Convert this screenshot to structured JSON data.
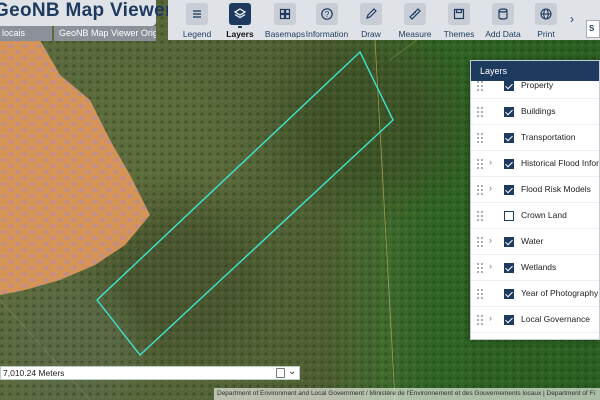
{
  "app": {
    "title": "GeoNB Map Viewer",
    "subtab_left": "locais",
    "subtab_right": "GeoNB Map Viewer Original"
  },
  "toolbar": {
    "tools": [
      {
        "label": "Legend",
        "icon": "list-icon",
        "active": false
      },
      {
        "label": "Layers",
        "icon": "layers-icon",
        "active": true
      },
      {
        "label": "Basemaps",
        "icon": "grid-icon",
        "active": false
      },
      {
        "label": "Information",
        "icon": "question-icon",
        "active": false
      },
      {
        "label": "Draw",
        "icon": "pen-icon",
        "active": false
      },
      {
        "label": "Measure",
        "icon": "ruler-icon",
        "active": false
      },
      {
        "label": "Themes",
        "icon": "save-icon",
        "active": false
      },
      {
        "label": "Add Data",
        "icon": "database-icon",
        "active": false
      },
      {
        "label": "Print",
        "icon": "globe-icon",
        "active": false
      }
    ],
    "more_icon": "chevron-right-icon",
    "search_stub": "S"
  },
  "layers_panel": {
    "title": "Layers",
    "layers": [
      {
        "name": "Property",
        "checked": true,
        "expandable": false
      },
      {
        "name": "Buildings",
        "checked": true,
        "expandable": false
      },
      {
        "name": "Transportation",
        "checked": true,
        "expandable": false
      },
      {
        "name": "Historical Flood Informa",
        "checked": true,
        "expandable": true
      },
      {
        "name": "Flood Risk Models",
        "checked": true,
        "expandable": true
      },
      {
        "name": "Crown Land",
        "checked": false,
        "expandable": false
      },
      {
        "name": "Water",
        "checked": true,
        "expandable": true
      },
      {
        "name": "Wetlands",
        "checked": true,
        "expandable": true
      },
      {
        "name": "Year of Photography",
        "checked": true,
        "expandable": false
      },
      {
        "name": "Local Governance",
        "checked": true,
        "expandable": true
      }
    ]
  },
  "scale": {
    "text": "7,010.24 Meters"
  },
  "attribution": "Department of Environment and Local Government / Ministère de l'Environnement et des Gouvernements locaux | Department of Fi",
  "colors": {
    "brand": "#1e3a5f",
    "toolbar_bg": "#dfe3e8",
    "property_fill": "#e39a5a",
    "polygon_outline": "#3ee6d0"
  }
}
